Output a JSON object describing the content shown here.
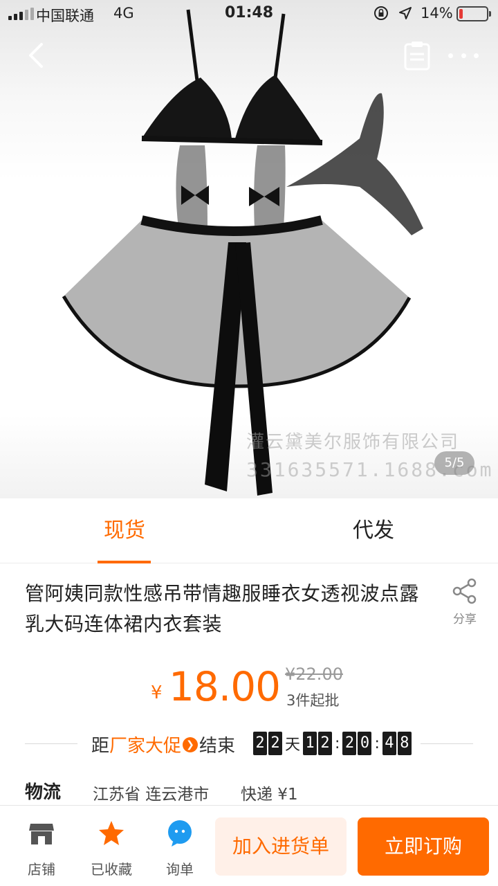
{
  "status_bar": {
    "carrier": "中国联通",
    "network": "4G",
    "time": "01:48",
    "battery": "14%",
    "battery_level": 0.14,
    "battery_color": "#e53935"
  },
  "nav": {
    "back_icon": "chevron-left-icon",
    "list_icon": "clipboard-list-icon",
    "more_icon": "ellipsis-icon"
  },
  "image": {
    "counter": "5/5",
    "watermark_line1": "灌云黛美尔服饰有限公司",
    "watermark_line2": "331635571.1688.com"
  },
  "tabs": [
    {
      "label": "现货",
      "active": true
    },
    {
      "label": "代发",
      "active": false
    }
  ],
  "product": {
    "title": "管阿姨同款性感吊带情趣服睡衣女透视波点露乳大码连体裙内衣套装",
    "share_label": "分享"
  },
  "price": {
    "currency": "¥",
    "value": "18.00",
    "original": "¥22.00",
    "min_order": "3件起批"
  },
  "promo": {
    "prefix": "距",
    "highlight": "厂家大促",
    "suffix": "结束",
    "days": [
      "2",
      "2"
    ],
    "day_unit": "天",
    "hours": [
      "1",
      "2"
    ],
    "minutes": [
      "2",
      "0"
    ],
    "seconds": [
      "4",
      "8"
    ],
    "sep": ":"
  },
  "logistics": {
    "label": "物流",
    "from": "江苏省 连云港市",
    "method": "快递 ¥1"
  },
  "bottom_bar": {
    "store_label": "店铺",
    "favorite_label": "已收藏",
    "inquiry_label": "询单",
    "cart_button": "加入进货单",
    "buy_button": "立即订购"
  },
  "colors": {
    "accent": "#ff6a00",
    "favorite_star": "#ff6a00",
    "inquiry_blue": "#1e9bf0"
  }
}
